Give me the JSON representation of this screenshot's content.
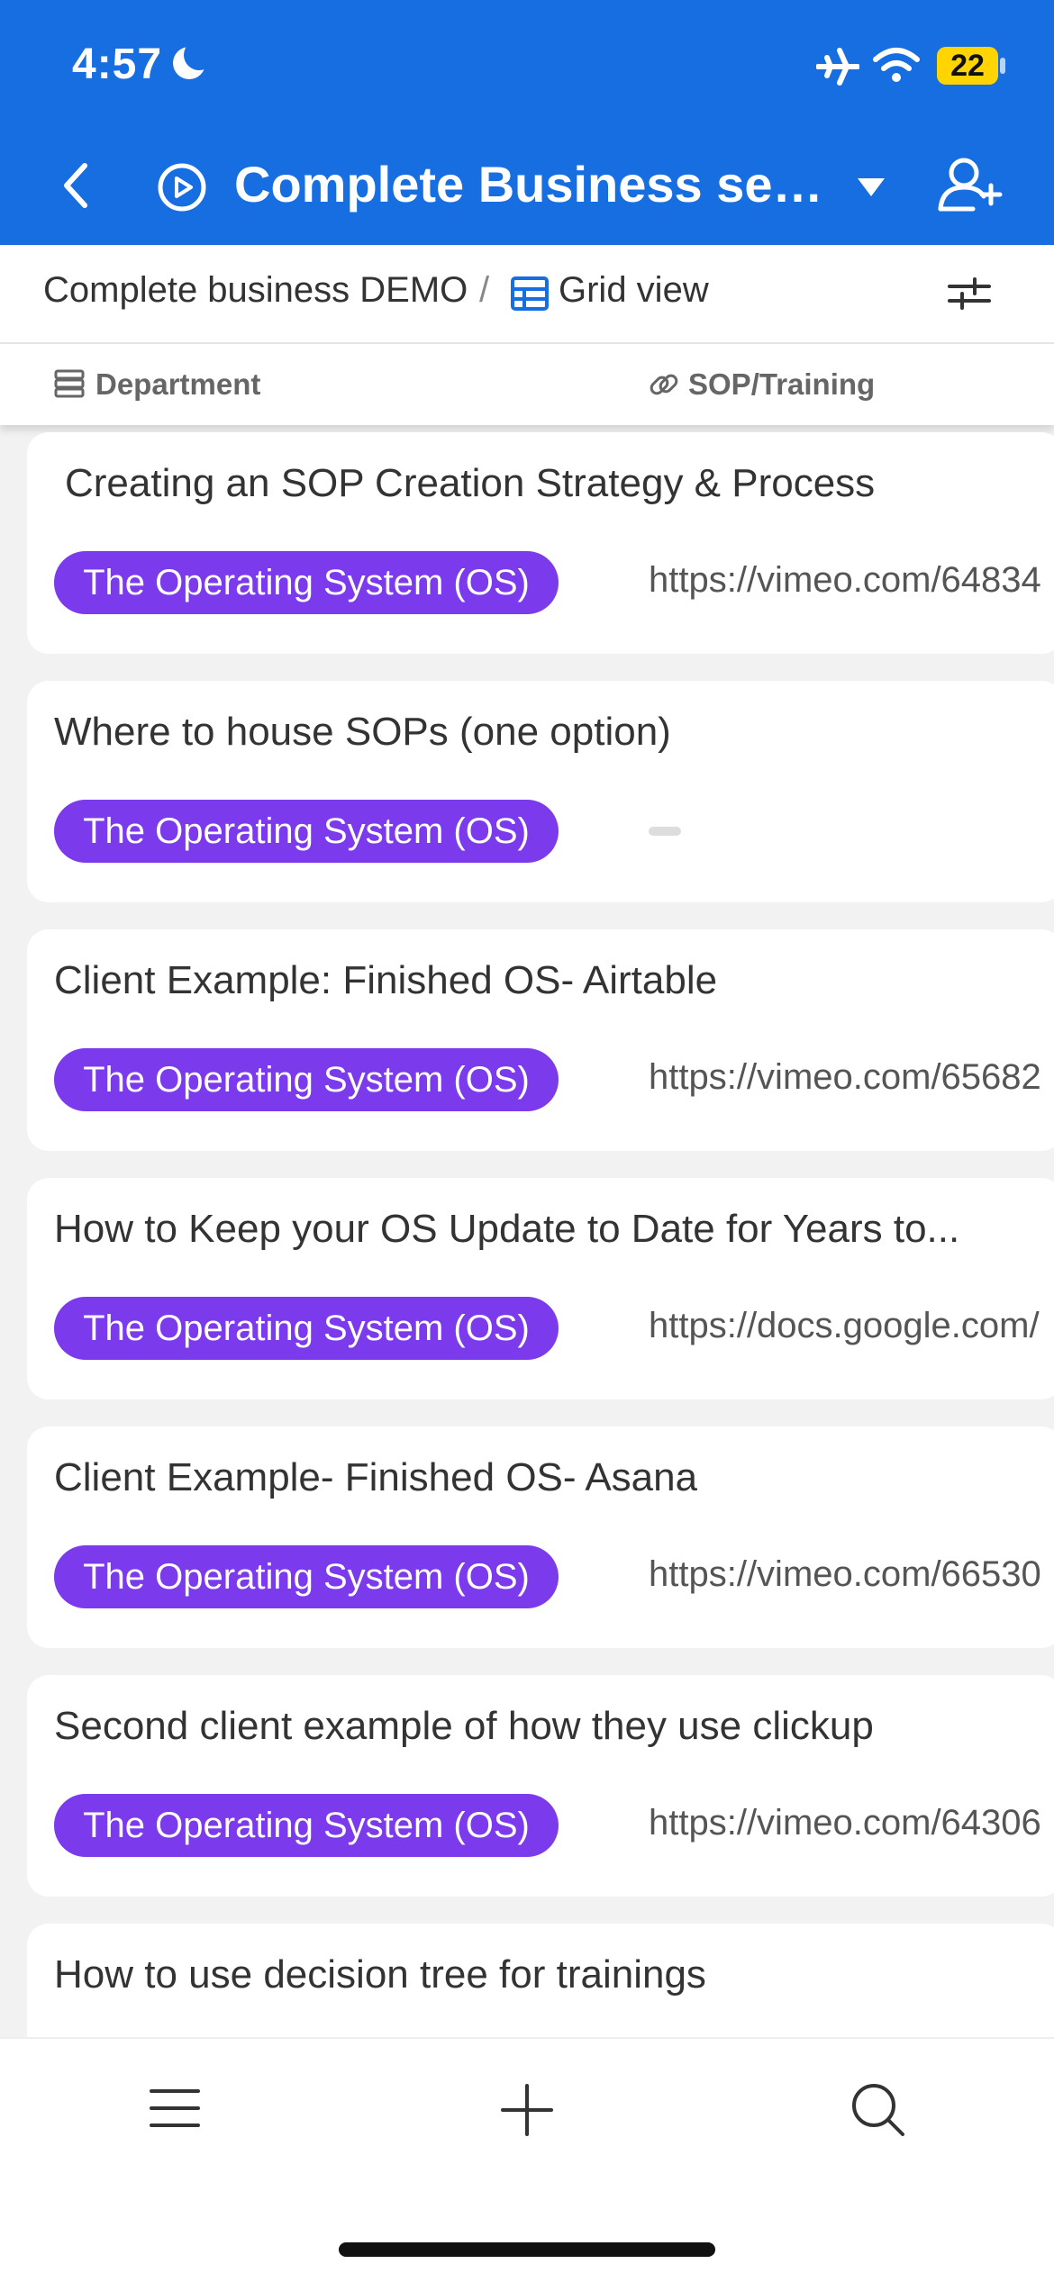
{
  "status_bar": {
    "time": "4:57",
    "battery": "22",
    "icons": [
      "moon-icon",
      "airplane-icon",
      "wifi-icon",
      "battery-icon"
    ]
  },
  "header": {
    "back_icon": "chevron-left-icon",
    "play_icon": "play-circle-icon",
    "title": "Complete Business setu...",
    "dropdown_icon": "caret-down-icon",
    "add_user_icon": "add-user-icon",
    "color": "#166ee1"
  },
  "toolbar": {
    "base_name": "Complete business DEMO",
    "separator": "/",
    "view_icon": "grid-icon",
    "view_name": "Grid view",
    "filter_icon": "sliders-icon"
  },
  "columns": [
    {
      "label": "Department",
      "icon": "list-icon"
    },
    {
      "label": "SOP/Training",
      "icon": "link-icon"
    }
  ],
  "records": [
    {
      "title": "Creating an SOP Creation Strategy & Process",
      "department": "The Operating System (OS)",
      "link": "https://vimeo.com/64834"
    },
    {
      "title": "Where to house SOPs (one option)",
      "department": "The Operating System (OS)",
      "link": ""
    },
    {
      "title": "Client Example: Finished OS- Airtable",
      "department": "The Operating System (OS)",
      "link": "https://vimeo.com/65682"
    },
    {
      "title": "How to Keep your OS Update to Date for Years to...",
      "department": "The Operating System (OS)",
      "link": "https://docs.google.com/"
    },
    {
      "title": "Client Example- Finished OS- Asana",
      "department": "The Operating System (OS)",
      "link": "https://vimeo.com/66530"
    },
    {
      "title": "Second client example of how they use clickup",
      "department": "The Operating System (OS)",
      "link": "https://vimeo.com/64306"
    },
    {
      "title": "How to use decision tree for trainings",
      "department": "",
      "link": ""
    }
  ],
  "bottom_bar": {
    "icons": [
      "menu-icon",
      "plus-icon",
      "search-icon"
    ]
  },
  "colors": {
    "pill": "#7c3aed",
    "header": "#166ee1"
  }
}
